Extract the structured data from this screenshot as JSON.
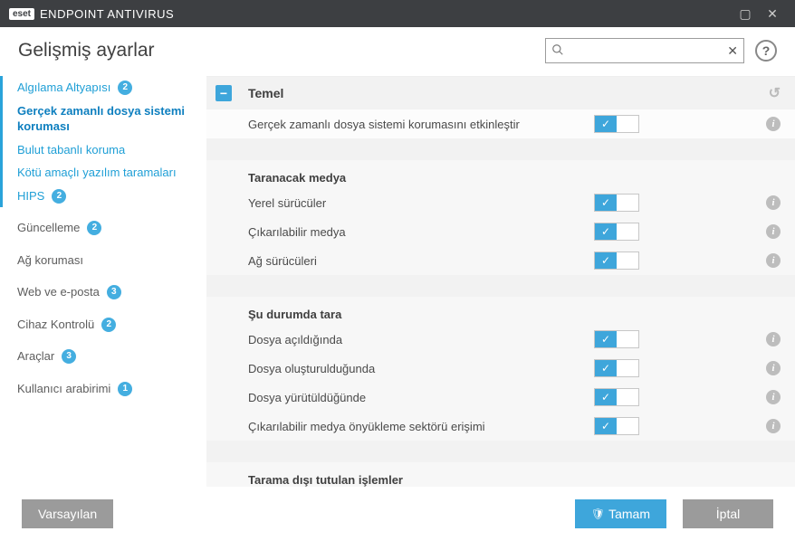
{
  "titlebar": {
    "brand": "eset",
    "product": "ENDPOINT ANTIVIRUS"
  },
  "header": {
    "title": "Gelişmiş ayarlar",
    "search_placeholder": ""
  },
  "sidebar": {
    "groups": [
      {
        "active": true,
        "items": [
          {
            "label": "Algılama Altyapısı",
            "badge": "2",
            "style": "parent"
          },
          {
            "label": "Gerçek zamanlı dosya sistemi koruması",
            "style": "selected"
          },
          {
            "label": "Bulut tabanlı koruma",
            "style": "parent"
          },
          {
            "label": "Kötü amaçlı yazılım taramaları",
            "style": "parent"
          },
          {
            "label": "HIPS",
            "badge": "2",
            "style": "parent"
          }
        ]
      },
      {
        "items": [
          {
            "label": "Güncelleme",
            "badge": "2",
            "style": "section"
          }
        ]
      },
      {
        "items": [
          {
            "label": "Ağ koruması",
            "style": "section"
          }
        ]
      },
      {
        "items": [
          {
            "label": "Web ve e-posta",
            "badge": "3",
            "style": "section"
          }
        ]
      },
      {
        "items": [
          {
            "label": "Cihaz Kontrolü",
            "badge": "2",
            "style": "section"
          }
        ]
      },
      {
        "items": [
          {
            "label": "Araçlar",
            "badge": "3",
            "style": "section"
          }
        ]
      },
      {
        "items": [
          {
            "label": "Kullanıcı arabirimi",
            "badge": "1",
            "style": "section"
          }
        ]
      }
    ]
  },
  "content": {
    "section_title": "Temel",
    "rows_basic": [
      {
        "label": "Gerçek zamanlı dosya sistemi korumasını etkinleştir",
        "on": true
      }
    ],
    "sub_media_title": "Taranacak medya",
    "rows_media": [
      {
        "label": "Yerel sürücüler",
        "on": true
      },
      {
        "label": "Çıkarılabilir medya",
        "on": true
      },
      {
        "label": "Ağ sürücüleri",
        "on": true
      }
    ],
    "sub_scanon_title": "Şu durumda tara",
    "rows_scanon": [
      {
        "label": "Dosya açıldığında",
        "on": true
      },
      {
        "label": "Dosya oluşturulduğunda",
        "on": true
      },
      {
        "label": "Dosya yürütüldüğünde",
        "on": true
      },
      {
        "label": "Çıkarılabilir medya önyükleme sektörü erişimi",
        "on": true
      }
    ],
    "sub_excluded_title": "Tarama dışı tutulan işlemler"
  },
  "footer": {
    "defaults": "Varsayılan",
    "ok": "Tamam",
    "cancel": "İptal"
  }
}
